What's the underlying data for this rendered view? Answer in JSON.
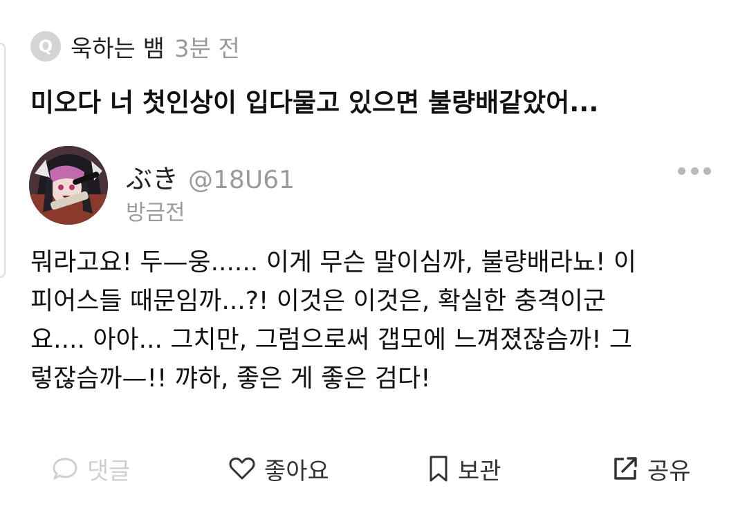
{
  "question": {
    "badge": "Q",
    "asker": "욱하는 뱀",
    "time": "3분 전",
    "text": "미오다 너 첫인상이 입다물고 있으면 불량배같았어..."
  },
  "answer": {
    "author_name": "ぶき",
    "author_handle": "@18U61",
    "time": "방금전",
    "body_lines": [
      "뭐라고요! 두—웅...... 이게 무슨 말이심까, 불량배라뇨! 이",
      "피어스들 때문임까...?! 이것은 이것은, 확실한 충격이군",
      "요.... 아아... 그치만, 그럼으로써 갭모에 느껴졌잖슴까! 그",
      "렇잖슴까—!! 꺄하, 좋은 게 좋은 검다!"
    ]
  },
  "actions": {
    "comment_label": "댓글",
    "like_label": "좋아요",
    "bookmark_label": "보관",
    "share_label": "공유"
  },
  "icons": {
    "question_badge": "q-badge-icon",
    "more": "more-dots-icon",
    "comment": "comment-bubble-icon",
    "like": "heart-icon",
    "bookmark": "bookmark-icon",
    "share": "share-arrow-icon"
  },
  "colors": {
    "primary_text": "#111111",
    "muted_text": "#9a9a9a",
    "disabled": "#cfcfcf",
    "badge_bg": "#d4d4d4"
  }
}
